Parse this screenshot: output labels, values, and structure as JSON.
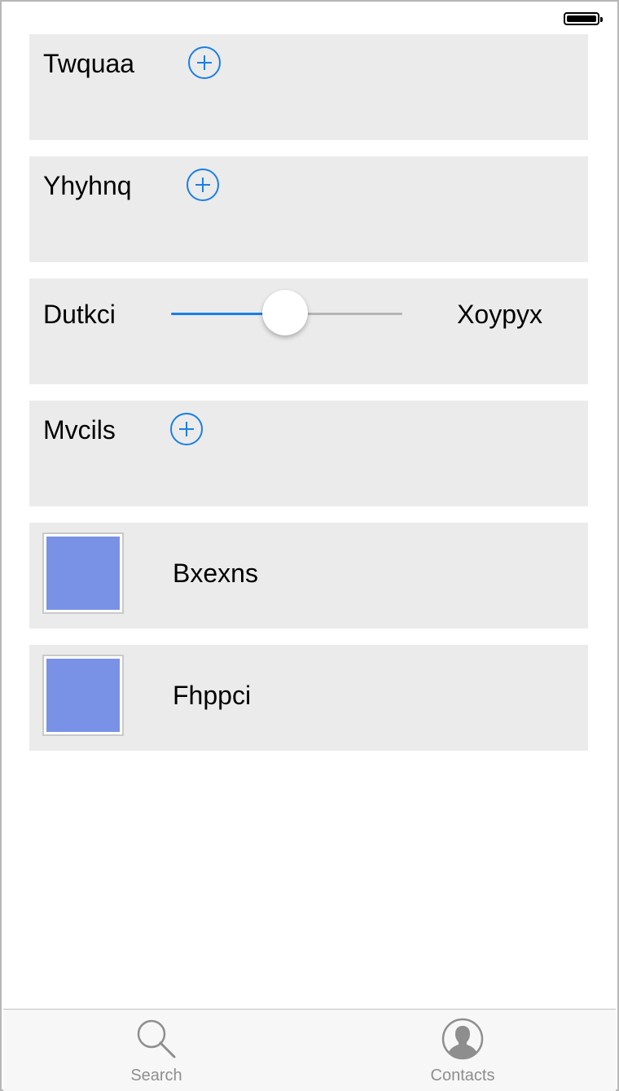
{
  "status_bar": {
    "battery_icon": "battery-full-icon"
  },
  "rows": [
    {
      "kind": "add",
      "label": "Twquaa",
      "icon": "plus-circle-icon"
    },
    {
      "kind": "add",
      "label": "Yhyhnq",
      "icon": "plus-circle-icon"
    },
    {
      "kind": "slider",
      "label": "Dutkci",
      "right_label": "Xoypyx",
      "value_fraction": 0.5
    },
    {
      "kind": "add",
      "label": "Mvcils",
      "icon": "plus-circle-icon"
    },
    {
      "kind": "swatch",
      "label": "Bxexns",
      "color": "#7a92e6"
    },
    {
      "kind": "swatch",
      "label": "Fhppci",
      "color": "#7a92e6"
    }
  ],
  "tabbar": {
    "tabs": [
      {
        "label": "Search",
        "icon": "search-icon"
      },
      {
        "label": "Contacts",
        "icon": "contact-avatar-icon"
      }
    ]
  },
  "colors": {
    "accent": "#1a7fe6",
    "card_bg": "#ebebeb",
    "tab_label": "#8e8e8e"
  }
}
